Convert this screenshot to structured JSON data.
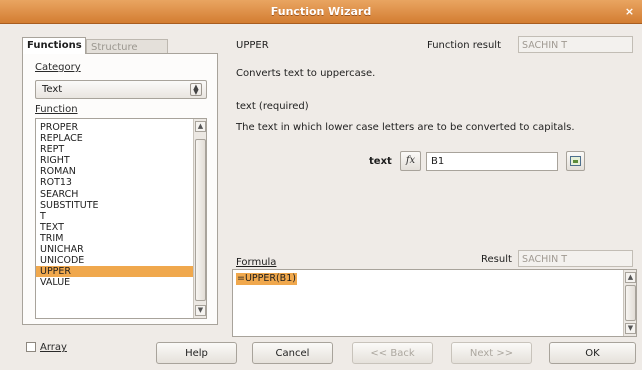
{
  "window": {
    "title": "Function Wizard",
    "close_glyph": "×"
  },
  "tabs": [
    {
      "label": "Functions",
      "active": true
    },
    {
      "label": "Structure",
      "active": false
    }
  ],
  "category": {
    "label": "Category",
    "value": "Text"
  },
  "function_list": {
    "label": "Function",
    "items": [
      "PROPER",
      "REPLACE",
      "REPT",
      "RIGHT",
      "ROMAN",
      "ROT13",
      "SEARCH",
      "SUBSTITUTE",
      "T",
      "TEXT",
      "TRIM",
      "UNICHAR",
      "UNICODE",
      "UPPER",
      "VALUE"
    ],
    "selected": "UPPER"
  },
  "array_label": "Array",
  "selected_function": {
    "name": "UPPER",
    "result_label": "Function result",
    "result_value": "SACHIN T",
    "description": "Converts text to uppercase.",
    "argument_heading": "text (required)",
    "argument_description": "The text in which lower case letters are to be converted to capitals.",
    "argument_label": "text",
    "argument_value": "B1"
  },
  "formula": {
    "label": "Formula",
    "result_label": "Result",
    "result_value": "SACHIN T",
    "value": "=UPPER(B1)"
  },
  "buttons": {
    "help": "Help",
    "cancel": "Cancel",
    "back": "<< Back",
    "next": "Next >>",
    "ok": "OK"
  },
  "colors": {
    "titlebar": "#d88a3e",
    "selection": "#f0a84d"
  }
}
